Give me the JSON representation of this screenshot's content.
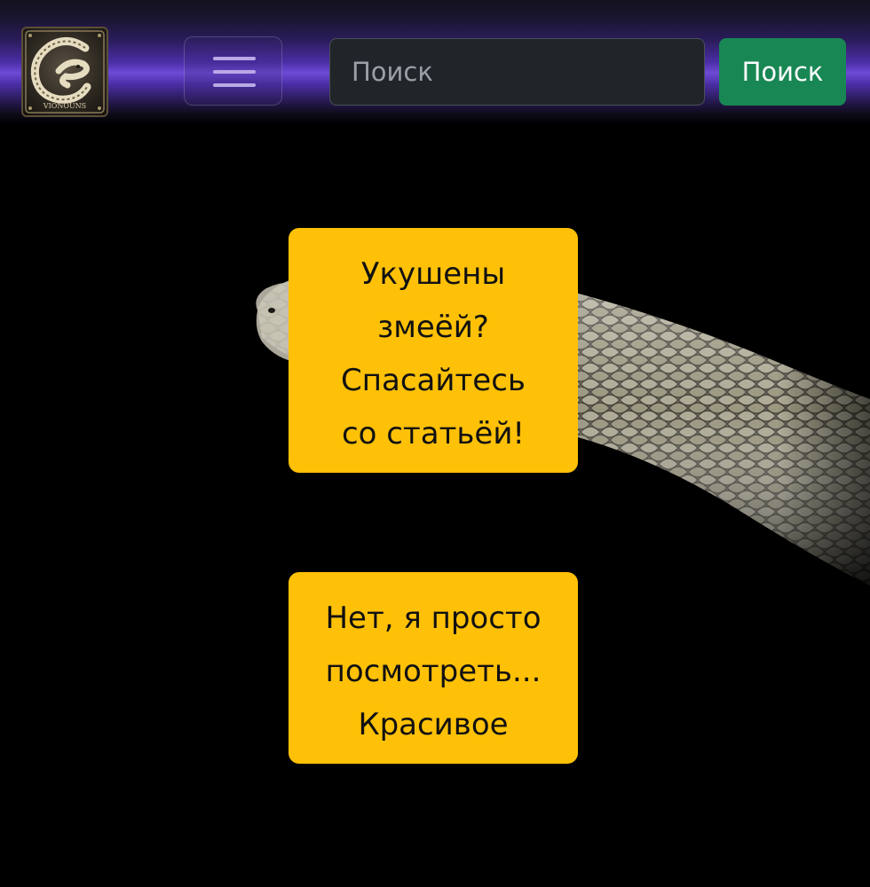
{
  "navbar": {
    "logo_label": "VIONOUNS",
    "search_placeholder": "Поиск",
    "search_button_label": "Поиск",
    "toggler_icon": "hamburger-icon",
    "colors": {
      "search_button": "#198754",
      "navbar_glow": "#6f4ad6"
    }
  },
  "main": {
    "prompt_card": "Укушены\nзмеёй?\nСпасайтесь\nсо статьёй!",
    "browse_card": "Нет, я просто\nпосмотреть...\nКрасивое",
    "colors": {
      "card_background": "#ffc107"
    }
  }
}
